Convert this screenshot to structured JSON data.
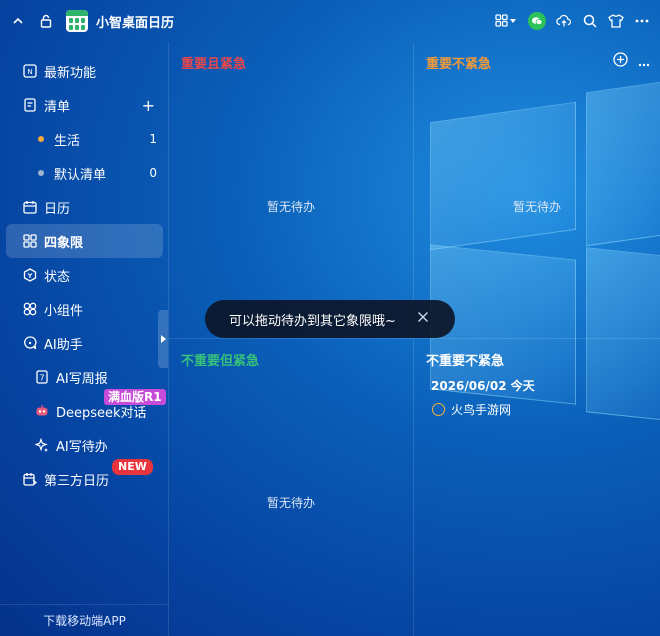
{
  "app": {
    "title": "小智桌面日历"
  },
  "sidebar": {
    "items": [
      {
        "label": "最新功能"
      },
      {
        "label": "清单"
      },
      {
        "label": "生活",
        "count": "1"
      },
      {
        "label": "默认清单",
        "count": "0"
      },
      {
        "label": "日历"
      },
      {
        "label": "四象限"
      },
      {
        "label": "状态"
      },
      {
        "label": "小组件"
      },
      {
        "label": "AI助手"
      },
      {
        "label": "AI写周报"
      },
      {
        "label": "Deepseek对话"
      },
      {
        "label": "AI写待办"
      },
      {
        "label": "第三方日历"
      }
    ],
    "badges": {
      "deepseek": "满血版R1",
      "third_party": "NEW"
    },
    "download_label": "下载移动端APP"
  },
  "quadrants": {
    "important_urgent": {
      "title": "重要且紧急",
      "empty": "暂无待办"
    },
    "important_not_urgent": {
      "title": "重要不紧急",
      "empty": "暂无待办"
    },
    "not_important_urgent": {
      "title": "不重要但紧急",
      "empty": "暂无待办"
    },
    "not_important_not_urgent": {
      "title": "不重要不紧急",
      "date_header": "2026/06/02 今天",
      "tasks": [
        {
          "label": "火鸟手游网"
        }
      ]
    }
  },
  "toast": {
    "message": "可以拖动待办到其它象限哦~"
  },
  "colors": {
    "important_urgent": "#e8474b",
    "important_not_urgent": "#f29a3a",
    "not_important_urgent": "#36c07a",
    "not_important_not_urgent": "#ffffff",
    "dot_life": "#f2a93a",
    "dot_default": "#9fb4cf"
  },
  "icons": {
    "titlebar": [
      "chevron-up-icon",
      "lock-icon",
      "app-logo",
      "apps-grid-icon",
      "wechat-icon",
      "cloud-upload-icon",
      "search-icon",
      "tshirt-icon",
      "more-icon"
    ]
  }
}
